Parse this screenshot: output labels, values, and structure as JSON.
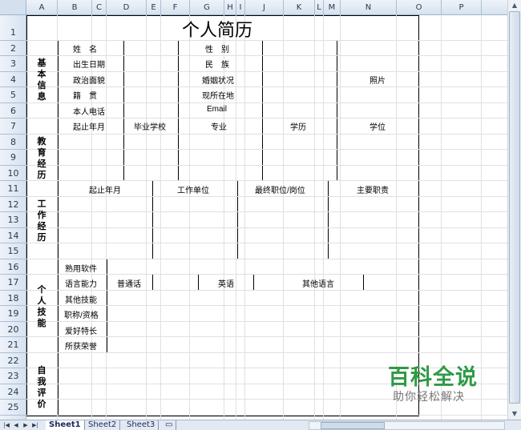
{
  "columns": [
    "A",
    "B",
    "C",
    "D",
    "E",
    "F",
    "G",
    "H",
    "I",
    "J",
    "K",
    "L",
    "M",
    "N",
    "O",
    "P"
  ],
  "rows": [
    "1",
    "2",
    "3",
    "4",
    "5",
    "6",
    "7",
    "8",
    "9",
    "10",
    "11",
    "12",
    "13",
    "14",
    "15",
    "16",
    "17",
    "18",
    "19",
    "20",
    "21",
    "22",
    "23",
    "24",
    "25"
  ],
  "title": "个人简历",
  "basic": {
    "section": "基本信息",
    "name": "姓　名",
    "birth": "出生日期",
    "politics": "政治面貌",
    "origin": "籍　贯",
    "phone": "本人电话",
    "gender": "性　别",
    "ethnic": "民　族",
    "marital": "婚姻状况",
    "address": "现所在地",
    "email": "Email",
    "photo": "照片"
  },
  "education": {
    "section": "教育经历",
    "period": "起止年月",
    "school": "毕业学校",
    "major": "专业",
    "record": "学历",
    "degree": "学位"
  },
  "work": {
    "section": "工作经历",
    "period": "起止年月",
    "company": "工作单位",
    "position": "最终职位/岗位",
    "duty": "主要职责"
  },
  "skills": {
    "section": "个人技能",
    "software": "熟用软件",
    "language": "语言能力",
    "mandarin": "普通话",
    "english": "英语",
    "other_lang": "其他语言",
    "other_skills": "其他技能",
    "titles": "职称/资格",
    "hobby": "爱好特长",
    "honors": "所获荣誉"
  },
  "self": {
    "section": "自我评价"
  },
  "sheets": [
    "Sheet1",
    "Sheet2",
    "Sheet3"
  ],
  "watermark": {
    "title": "百科全说",
    "subtitle": "助你轻松解决"
  },
  "accent": "#2e9a46"
}
